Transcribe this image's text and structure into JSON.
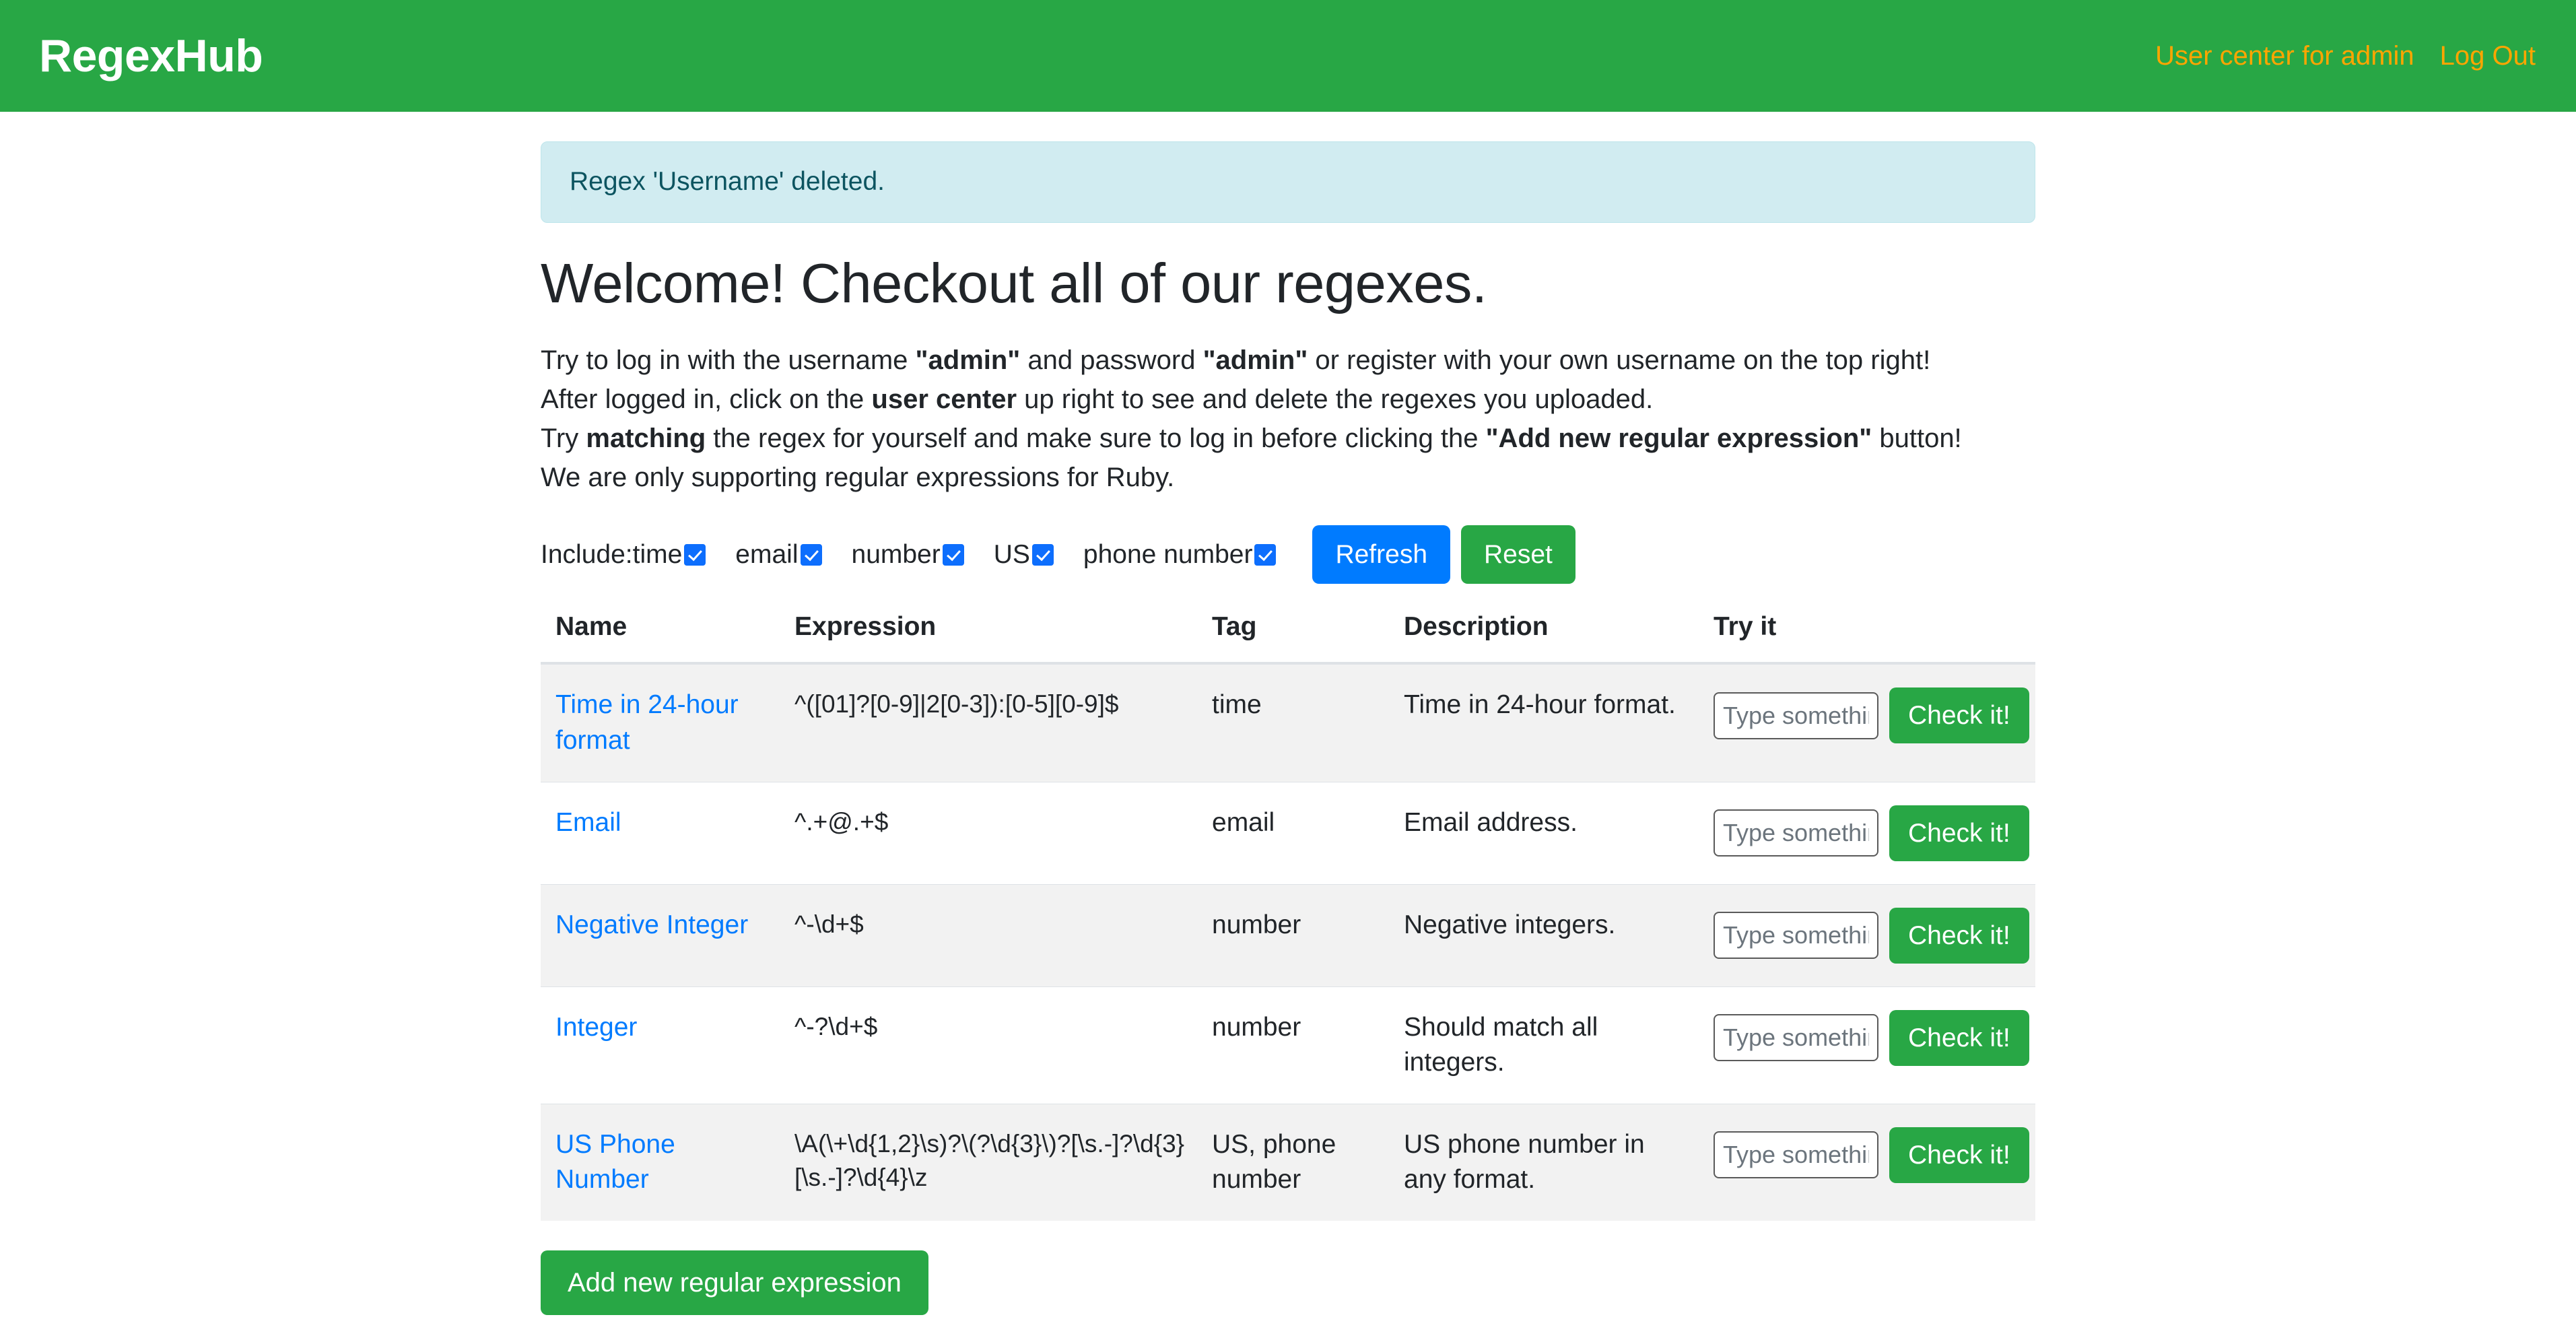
{
  "navbar": {
    "brand": "RegexHub",
    "links": [
      {
        "label": "User center for admin",
        "name": "user-center-link"
      },
      {
        "label": "Log Out",
        "name": "log-out-link"
      }
    ]
  },
  "alert": {
    "message": "Regex 'Username' deleted.",
    "style_color": "#d1ecf1",
    "text_color": "#0c5460"
  },
  "main": {
    "title": "Welcome! Checkout all of our regexes.",
    "intro": {
      "line1_a": "Try to log in with the username ",
      "line1_b": "\"admin\"",
      "line1_c": " and password ",
      "line1_d": "\"admin\"",
      "line1_e": " or register with your own username on the top right!",
      "line2_a": "After logged in, click on the ",
      "line2_b": "user center",
      "line2_c": " up right to see and delete the regexes you uploaded.",
      "line3_a": "Try ",
      "line3_b": "matching",
      "line3_c": " the regex for yourself and make sure to log in before clicking the ",
      "line3_d": "\"Add new regular expression\"",
      "line3_e": " button!",
      "line4": "We are only supporting regular expressions for Ruby."
    }
  },
  "filters": {
    "lead_label": "Include:",
    "items": [
      {
        "label": "time",
        "checked": true,
        "name": "filter-checkbox-time"
      },
      {
        "label": "email",
        "checked": true,
        "name": "filter-checkbox-email"
      },
      {
        "label": "number",
        "checked": true,
        "name": "filter-checkbox-number"
      },
      {
        "label": "US",
        "checked": true,
        "name": "filter-checkbox-us"
      },
      {
        "label": "phone number",
        "checked": true,
        "name": "filter-checkbox-phone-number"
      }
    ],
    "refresh_label": "Refresh",
    "reset_label": "Reset",
    "refresh_color": "#007bff",
    "reset_color": "#28a745"
  },
  "table": {
    "headers": {
      "name": "Name",
      "expression": "Expression",
      "tag": "Tag",
      "description": "Description",
      "try_it": "Try it"
    },
    "try_placeholder": "Type something",
    "check_label": "Check it!",
    "rows": [
      {
        "name": "Time in 24-hour format",
        "expression": "^([01]?[0-9]|2[0-3]):[0-5][0-9]$",
        "tag": "time",
        "description": "Time in 24-hour format."
      },
      {
        "name": "Email",
        "expression": "^.+@.+$",
        "tag": "email",
        "description": "Email address."
      },
      {
        "name": "Negative Integer",
        "expression": "^-\\d+$",
        "tag": "number",
        "description": "Negative integers."
      },
      {
        "name": "Integer",
        "expression": "^-?\\d+$",
        "tag": "number",
        "description": "Should match all integers."
      },
      {
        "name": "US Phone Number",
        "expression": "\\A(\\+\\d{1,2}\\s)?\\(?\\d{3}\\)?[\\s.-]?\\d{3}[\\s.-]?\\d{4}\\z",
        "tag": "US, phone number",
        "description": "US phone number in any format."
      }
    ]
  },
  "footer": {
    "add_label": "Add new regular expression",
    "add_color": "#28a745"
  }
}
